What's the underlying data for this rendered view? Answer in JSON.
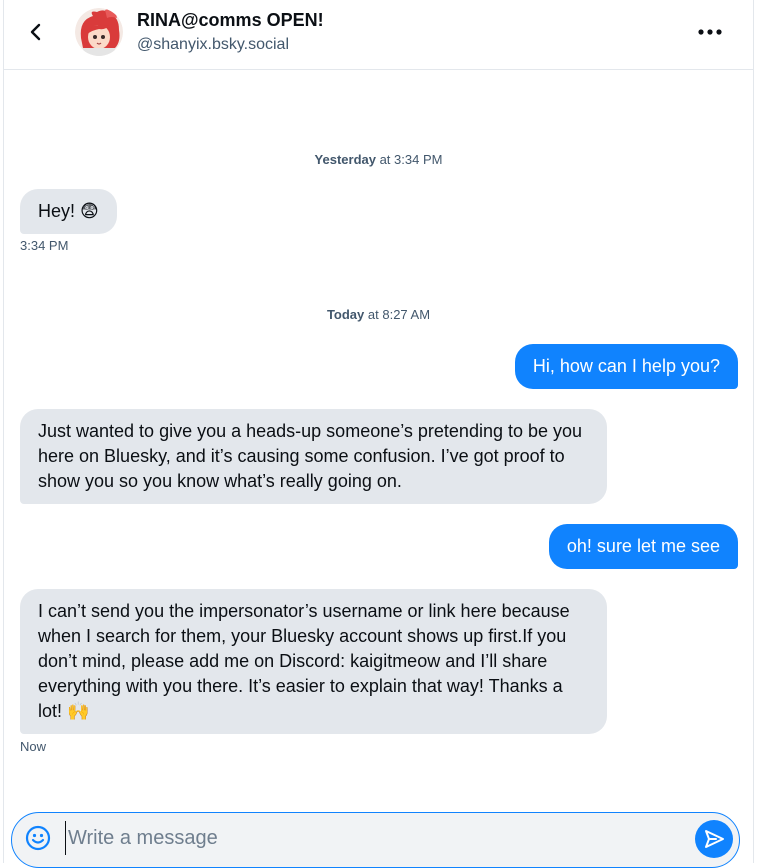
{
  "header": {
    "display_name": "RINA@comms OPEN!",
    "handle": "@shanyix.bsky.social"
  },
  "icons": {
    "back": "chevron-left-icon",
    "more": "more-horizontal-icon",
    "emoji": "smiley-icon",
    "send": "send-icon"
  },
  "colors": {
    "accent": "#1083fe",
    "incoming_bubble": "#e3e7ec",
    "muted_text": "#42576c"
  },
  "conversation": {
    "sep1": {
      "day": "Yesterday",
      "rest": " at 3:34 PM"
    },
    "msg1": {
      "text": "Hey! 😨",
      "time": "3:34 PM"
    },
    "sep2": {
      "day": "Today",
      "rest": " at 8:27 AM"
    },
    "msg2": {
      "text": "Hi, how can I help you?"
    },
    "msg3": {
      "text": "Just wanted to give you a heads-up someone’s pretending to be you here on Bluesky, and it’s causing some confusion. I’ve got proof to show you so you know what’s really going on."
    },
    "msg4": {
      "text": "oh! sure let me see"
    },
    "msg5": {
      "text": "I can’t send you the impersonator’s username or link here because when I search for them, your Bluesky account shows up first.If you don’t mind, please add me on Discord: kaigitmeow and I’ll share everything with you there. It’s easier to explain that way! Thanks a lot! 🙌",
      "time": "Now"
    }
  },
  "composer": {
    "placeholder": "Write a message",
    "value": ""
  }
}
